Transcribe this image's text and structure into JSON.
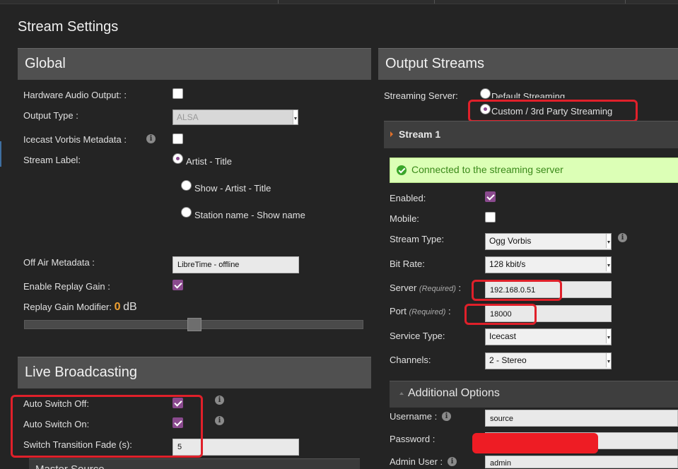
{
  "page": {
    "title": "Stream Settings"
  },
  "global": {
    "heading": "Global",
    "hardware_audio_output_label": "Hardware Audio Output: :",
    "output_type_label": "Output Type :",
    "output_type_value": "ALSA",
    "icecast_vorbis_metadata_label": "Icecast Vorbis Metadata :",
    "stream_label_label": "Stream Label:",
    "stream_label_options": [
      "Artist - Title",
      "Show - Artist - Title",
      "Station name - Show name"
    ],
    "off_air_metadata_label": "Off Air Metadata :",
    "off_air_metadata_value": "LibreTime - offline",
    "enable_replay_gain_label": "Enable Replay Gain :",
    "replay_gain_modifier_label": "Replay Gain Modifier:",
    "replay_gain_value": "0",
    "replay_gain_unit": "dB",
    "replay_gain_level_fraction": 0.5
  },
  "live": {
    "heading": "Live Broadcasting",
    "auto_switch_off_label": "Auto Switch Off:",
    "auto_switch_on_label": "Auto Switch On:",
    "switch_fade_label": "Switch Transition Fade (s):",
    "switch_fade_value": "5",
    "master_source_label": "Master Source"
  },
  "output": {
    "heading": "Output Streams",
    "streaming_server_label": "Streaming Server:",
    "server_options": [
      "Default Streaming",
      "Custom / 3rd Party Streaming"
    ],
    "stream_heading": "Stream 1",
    "status_text": "Connected to the streaming server",
    "enabled_label": "Enabled:",
    "mobile_label": "Mobile:",
    "stream_type_label": "Stream Type:",
    "stream_type_value": "Ogg Vorbis",
    "bit_rate_label": "Bit Rate:",
    "bit_rate_value": "128 kbit/s",
    "server_label": "Server",
    "required_text": "(Required)",
    "server_value": "192.168.0.51",
    "port_label": "Port",
    "port_value": "18000",
    "service_type_label": "Service Type:",
    "service_type_value": "Icecast",
    "channels_label": "Channels:",
    "channels_value": "2 - Stereo",
    "additional_options_heading": "Additional Options",
    "username_label": "Username :",
    "username_value": "source",
    "password_label": "Password :",
    "admin_user_label": "Admin User :",
    "admin_user_value": "admin"
  },
  "colors": {
    "accent_purple": "#8a4a8e",
    "annotation_red": "#e0202a",
    "replay_gain_orange": "#f0a030",
    "success_green": "#3aa62a"
  }
}
